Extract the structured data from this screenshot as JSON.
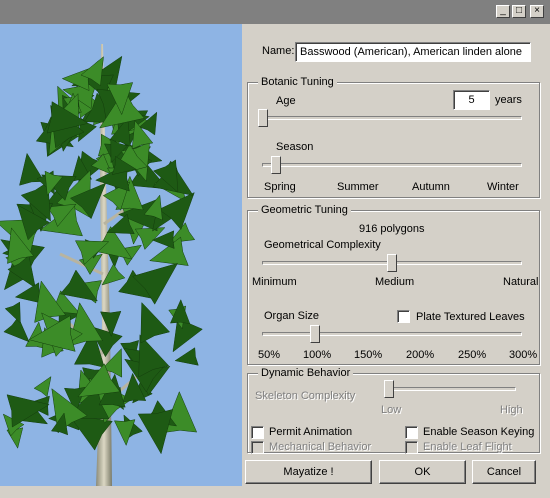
{
  "window": {
    "minimize_glyph": "_",
    "maximize_glyph": "□",
    "close_glyph": "×"
  },
  "name": {
    "label": "Name:",
    "value": "Basswood (American), American linden alone"
  },
  "botanic": {
    "legend": "Botanic Tuning",
    "age_label": "Age",
    "age_value": "5",
    "age_unit": "years",
    "age_slider_level": 0.0,
    "season_label": "Season",
    "season_slider_level": 0.05,
    "season_ticks": [
      "Spring",
      "Summer",
      "Autumn",
      "Winter"
    ]
  },
  "geometric": {
    "legend": "Geometric Tuning",
    "polygon_count": "916 polygons",
    "complexity_label": "Geometrical Complexity",
    "complexity_slider_level": 0.5,
    "complexity_ticks": [
      "Minimum",
      "Medium",
      "Natural"
    ],
    "organ_label": "Organ Size",
    "plate_label": "Plate Textured Leaves",
    "organ_slider_level": 0.2,
    "organ_ticks": [
      "50%",
      "100%",
      "150%",
      "200%",
      "250%",
      "300%"
    ]
  },
  "dynamic": {
    "legend": "Dynamic Behavior",
    "skeleton_label": "Skeleton Complexity",
    "skeleton_slider_level": 0.0,
    "skeleton_low": "Low",
    "skeleton_high": "High",
    "permit_animation": "Permit Animation",
    "enable_season_keying": "Enable Season Keying",
    "mechanical_behavior": "Mechanical Behavior",
    "enable_leaf_flight": "Enable Leaf Flight"
  },
  "buttons": {
    "mayatize": "Mayatize !",
    "ok": "OK",
    "cancel": "Cancel"
  },
  "colors": {
    "sky": "#8eb4e4",
    "leaf_dark": "#1e5a14",
    "leaf_light": "#3c8c28",
    "trunk": "#c8c4b0"
  }
}
